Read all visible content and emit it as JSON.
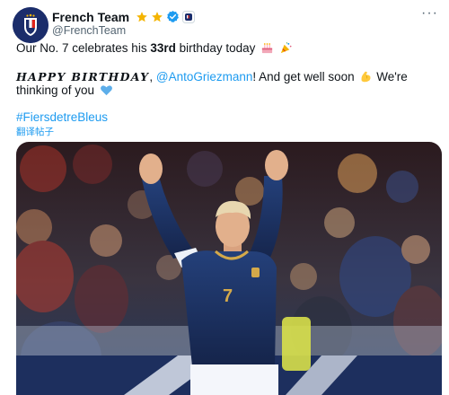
{
  "tweet": {
    "display_name": "French Team",
    "handle": "@FrenchTeam",
    "line1": {
      "prefix": "Our No. 7 celebrates his ",
      "bold": "33rd",
      "suffix": " birthday today"
    },
    "line2": {
      "bold_caps": "HAPPY BIRTHDAY",
      "comma": ",",
      "mention": "@AntoGriezmann",
      "middle": "! And get well soon",
      "tail": " We're"
    },
    "line3": "thinking of you",
    "hashtag": "#FiersdetreBleus",
    "translate_label": "翻译帖子"
  },
  "icons": {
    "stars": "star-icon",
    "verified": "verified-badge-icon",
    "affiliate": "affiliate-badge-icon",
    "emoji": [
      "birthday-cake-icon",
      "party-popper-icon",
      "flexed-biceps-icon",
      "blue-heart-icon"
    ]
  },
  "colors": {
    "link": "#1d9bf0",
    "star": "#f4b400",
    "verified": "#1d9bf0",
    "text": "#0f1419",
    "muted": "#536471"
  }
}
